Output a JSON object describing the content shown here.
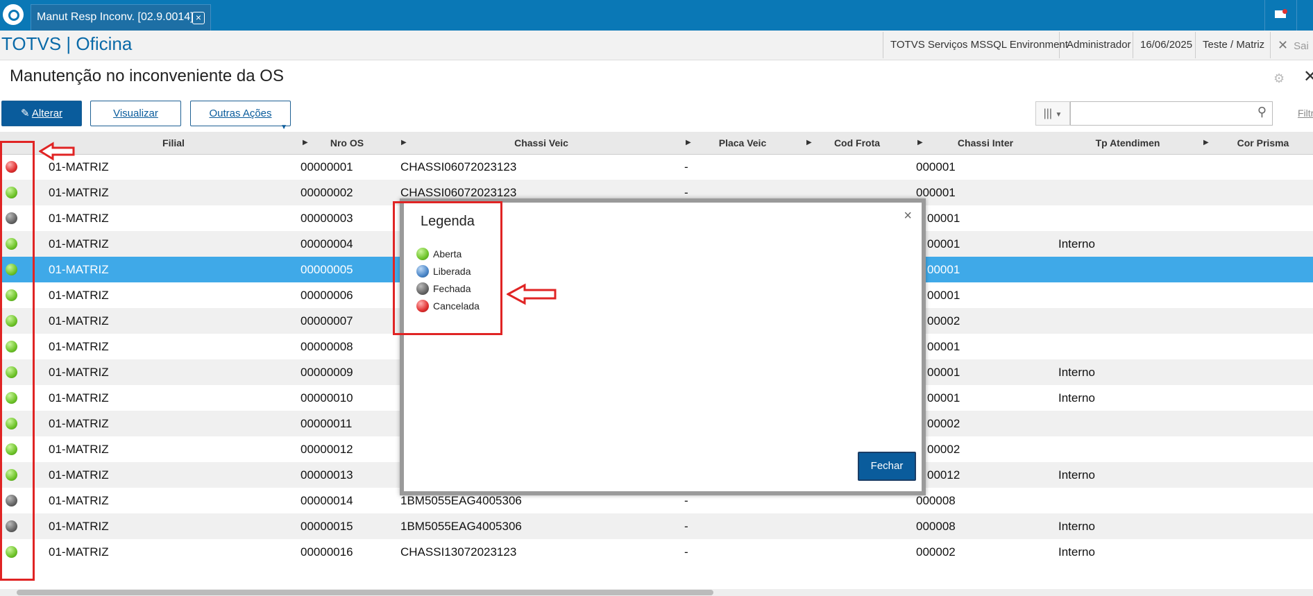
{
  "window": {
    "tab_title": "Manut Resp Inconv. [02.9.0014]",
    "tab_close": "×"
  },
  "header": {
    "brand": "TOTVS | Oficina",
    "environment": "TOTVS Serviços MSSQL Environment",
    "user": "Administrador",
    "date": "16/06/2025",
    "branch": "Teste / Matriz",
    "exit_label": "Sai"
  },
  "page": {
    "title": "Manutenção no inconveniente da OS",
    "filter_link": "Filtr"
  },
  "toolbar": {
    "alterar": "Alterar",
    "visualizar": "Visualizar",
    "outras_acoes": "Outras Ações",
    "search_placeholder": ""
  },
  "grid": {
    "columns": [
      "Filial",
      "Nro OS",
      "Chassi Veic",
      "Placa Veic",
      "Cod Frota",
      "Chassi Inter",
      "Tp Atendimen",
      "Cor Prisma"
    ],
    "rows": [
      {
        "status": "red",
        "filial": "01-MATRIZ",
        "nro_os": "00000001",
        "chassi_veic": "CHASSI06072023123",
        "placa": "-",
        "chassi_inter": "000001",
        "tp_atend": ""
      },
      {
        "status": "green",
        "filial": "01-MATRIZ",
        "nro_os": "00000002",
        "chassi_veic": "CHASSI06072023123",
        "placa": "-",
        "chassi_inter": "000001",
        "tp_atend": ""
      },
      {
        "status": "gray",
        "filial": "01-MATRIZ",
        "nro_os": "00000003",
        "chassi_veic": "",
        "placa": "",
        "chassi_inter": "00001",
        "tp_atend": ""
      },
      {
        "status": "green",
        "filial": "01-MATRIZ",
        "nro_os": "00000004",
        "chassi_veic": "",
        "placa": "",
        "chassi_inter": "00001",
        "tp_atend": "Interno"
      },
      {
        "status": "green",
        "filial": "01-MATRIZ",
        "nro_os": "00000005",
        "chassi_veic": "",
        "placa": "",
        "chassi_inter": "00001",
        "tp_atend": ""
      },
      {
        "status": "green",
        "filial": "01-MATRIZ",
        "nro_os": "00000006",
        "chassi_veic": "",
        "placa": "",
        "chassi_inter": "00001",
        "tp_atend": ""
      },
      {
        "status": "green",
        "filial": "01-MATRIZ",
        "nro_os": "00000007",
        "chassi_veic": "",
        "placa": "",
        "chassi_inter": "00002",
        "tp_atend": ""
      },
      {
        "status": "green",
        "filial": "01-MATRIZ",
        "nro_os": "00000008",
        "chassi_veic": "",
        "placa": "",
        "chassi_inter": "00001",
        "tp_atend": ""
      },
      {
        "status": "green",
        "filial": "01-MATRIZ",
        "nro_os": "00000009",
        "chassi_veic": "",
        "placa": "",
        "chassi_inter": "00001",
        "tp_atend": "Interno"
      },
      {
        "status": "green",
        "filial": "01-MATRIZ",
        "nro_os": "00000010",
        "chassi_veic": "",
        "placa": "",
        "chassi_inter": "00001",
        "tp_atend": "Interno"
      },
      {
        "status": "green",
        "filial": "01-MATRIZ",
        "nro_os": "00000011",
        "chassi_veic": "",
        "placa": "",
        "chassi_inter": "00002",
        "tp_atend": ""
      },
      {
        "status": "green",
        "filial": "01-MATRIZ",
        "nro_os": "00000012",
        "chassi_veic": "",
        "placa": "",
        "chassi_inter": "00002",
        "tp_atend": ""
      },
      {
        "status": "green",
        "filial": "01-MATRIZ",
        "nro_os": "00000013",
        "chassi_veic": "",
        "placa": "",
        "chassi_inter": "00012",
        "tp_atend": "Interno"
      },
      {
        "status": "gray",
        "filial": "01-MATRIZ",
        "nro_os": "00000014",
        "chassi_veic": "1BM5055EAG4005306",
        "placa": "-",
        "chassi_inter": "000008",
        "tp_atend": ""
      },
      {
        "status": "gray",
        "filial": "01-MATRIZ",
        "nro_os": "00000015",
        "chassi_veic": "1BM5055EAG4005306",
        "placa": "-",
        "chassi_inter": "000008",
        "tp_atend": "Interno"
      },
      {
        "status": "green",
        "filial": "01-MATRIZ",
        "nro_os": "00000016",
        "chassi_veic": "CHASSI13072023123",
        "placa": "-",
        "chassi_inter": "000002",
        "tp_atend": "Interno"
      }
    ]
  },
  "legend_modal": {
    "title": "Legenda",
    "close": "×",
    "items": [
      {
        "label": "Aberta",
        "color": "green"
      },
      {
        "label": "Liberada",
        "color": "blue"
      },
      {
        "label": "Fechada",
        "color": "gray"
      },
      {
        "label": "Cancelada",
        "color": "red"
      }
    ],
    "close_button": "Fechar"
  },
  "colors": {
    "topbar": "#0a78b6",
    "primary_button": "#0a5c9c",
    "selected_row": "#3fa9e8",
    "annotation_red": "#e02424"
  }
}
